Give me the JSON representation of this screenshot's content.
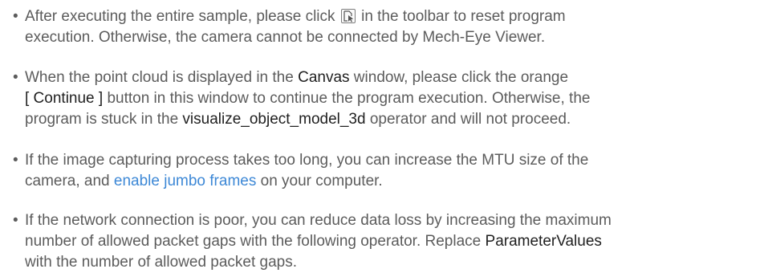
{
  "notes": [
    {
      "bullet": "•",
      "lines": [
        {
          "before": "After executing the entire sample, please click ",
          "icon": "reset-program-icon",
          "after": " in the toolbar to reset program"
        },
        {
          "text": "execution. Otherwise, the camera cannot be connected by Mech-Eye Viewer."
        }
      ]
    },
    {
      "bullet": "•",
      "lines": [
        {
          "before": "When the point cloud is displayed in the ",
          "em": "Canvas",
          "after": " window, please click the orange"
        },
        {
          "em": "[ Continue ]",
          "after": " button in this window to continue the program execution. Otherwise, the"
        },
        {
          "before": "program is stuck in the ",
          "em": "visualize_object_model_3d",
          "after": " operator and will not proceed."
        }
      ]
    },
    {
      "bullet": "•",
      "lines": [
        {
          "text": "If the image capturing process takes too long, you can increase the MTU size of the"
        },
        {
          "before": "camera, and ",
          "link": "enable jumbo frames",
          "after": " on your computer."
        }
      ]
    },
    {
      "bullet": "•",
      "lines": [
        {
          "text": "If the network connection is poor, you can reduce data loss by increasing the maximum"
        },
        {
          "before": "number of allowed packet gaps with the following operator. Replace ",
          "em": "ParameterValues"
        },
        {
          "text": "with the number of allowed packet gaps."
        }
      ]
    }
  ]
}
